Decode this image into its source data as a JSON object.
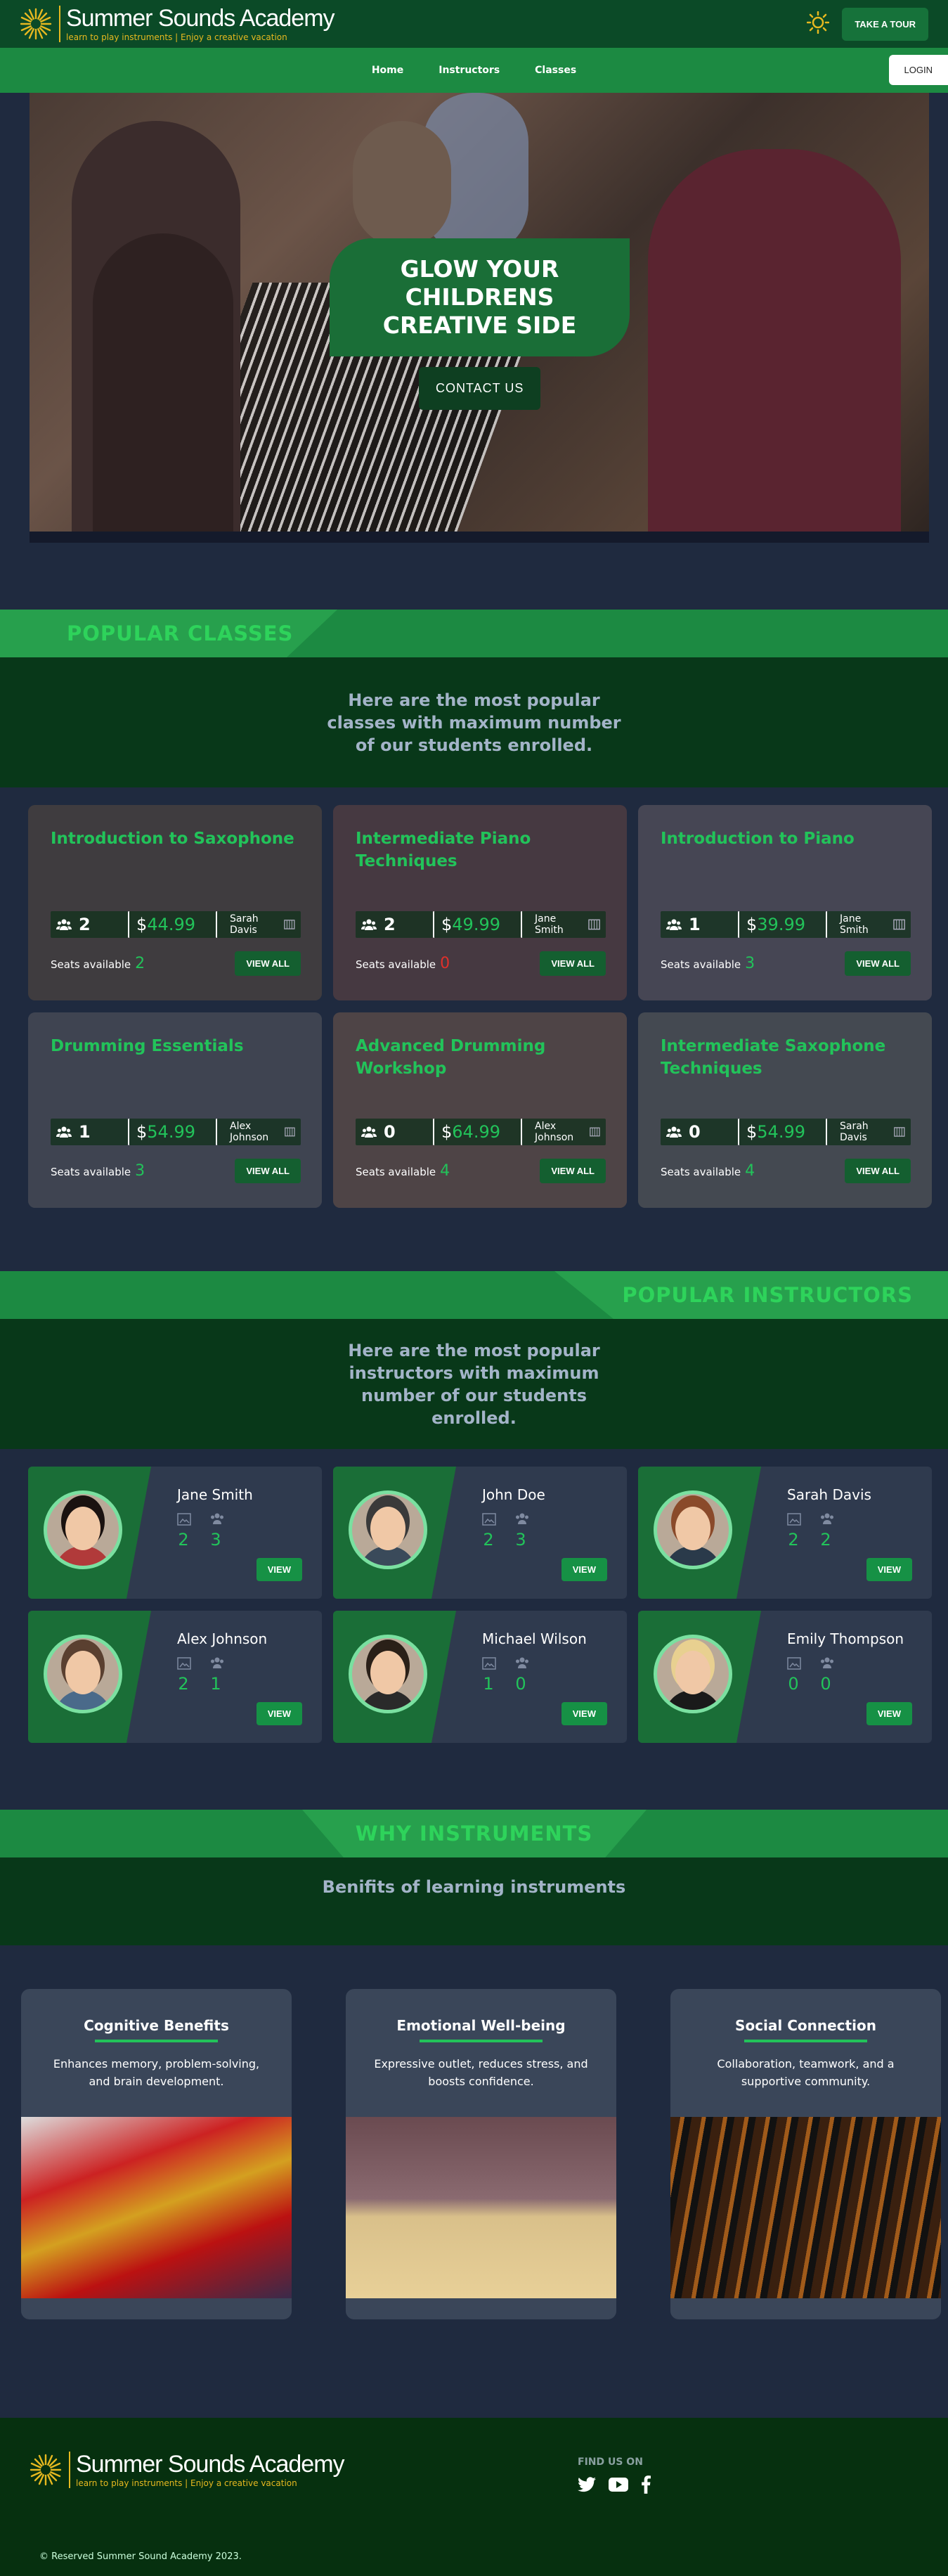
{
  "header": {
    "brand_name": "Summer Sounds Academy",
    "brand_tagline": "learn to play instruments | Enjoy a creative vacation",
    "tour_label": "TAKE A TOUR",
    "theme_icon": "sun-icon"
  },
  "nav": {
    "items": [
      "Home",
      "Instructors",
      "Classes"
    ],
    "login_label": "LOGIN"
  },
  "hero": {
    "title": "GLOW YOUR CHILDRENS CREATIVE SIDE",
    "cta_label": "CONTACT US"
  },
  "popular_classes": {
    "heading": "POPULAR CLASSES",
    "subtitle": "Here are the most popular classes with maximum number of our students enrolled.",
    "seats_label": "Seats available",
    "view_label": "VIEW ALL",
    "items": [
      {
        "title": "Introduction to Saxophone",
        "students": "2",
        "price": "44.99",
        "instructor": "Sarah Davis",
        "seats": "2",
        "seats_color": "#22c35a",
        "bg": "#4b4338"
      },
      {
        "title": "Intermediate Piano Techniques",
        "students": "2",
        "price": "49.99",
        "instructor": "Jane Smith",
        "seats": "0",
        "seats_color": "#e0302a",
        "bg": "#5a3d3d"
      },
      {
        "title": "Introduction to Piano",
        "students": "1",
        "price": "39.99",
        "instructor": "Jane Smith",
        "seats": "3",
        "seats_color": "#22c35a",
        "bg": "#5a5a66"
      },
      {
        "title": "Drumming Essentials",
        "students": "1",
        "price": "54.99",
        "instructor": "Alex Johnson",
        "seats": "3",
        "seats_color": "#22c35a",
        "bg": "#4a5560"
      },
      {
        "title": "Advanced Drumming Workshop",
        "students": "0",
        "price": "64.99",
        "instructor": "Alex Johnson",
        "seats": "4",
        "seats_color": "#22c35a",
        "bg": "#6a5548"
      },
      {
        "title": "Intermediate Saxophone Techniques",
        "students": "0",
        "price": "54.99",
        "instructor": "Sarah Davis",
        "seats": "4",
        "seats_color": "#22c35a",
        "bg": "#556060"
      }
    ]
  },
  "popular_instructors": {
    "heading": "POPULAR INSTRUCTORS",
    "subtitle": "Here are the most popular instructors with maximum number of our students enrolled.",
    "view_label": "VIEW",
    "items": [
      {
        "name": "Jane Smith",
        "classes": "2",
        "students": "3",
        "shirt": "#b13a3a",
        "hair": "#1a1210"
      },
      {
        "name": "John Doe",
        "classes": "2",
        "students": "3",
        "shirt": "#3a4a5a",
        "hair": "#3a3a3a"
      },
      {
        "name": "Sarah Davis",
        "classes": "2",
        "students": "2",
        "shirt": "#2a3a4a",
        "hair": "#8a4a2a"
      },
      {
        "name": "Alex Johnson",
        "classes": "2",
        "students": "1",
        "shirt": "#4a6a8a",
        "hair": "#5a4030"
      },
      {
        "name": "Michael Wilson",
        "classes": "1",
        "students": "0",
        "shirt": "#2a2a2a",
        "hair": "#2a2018"
      },
      {
        "name": "Emily Thompson",
        "classes": "0",
        "students": "0",
        "shirt": "#1a1a1a",
        "hair": "#e8d090"
      }
    ]
  },
  "why": {
    "heading": "WHY INSTRUMENTS",
    "subtitle": "Benifits of learning instruments",
    "items": [
      {
        "title": "Cognitive Benefits",
        "text": "Enhances memory, problem-solving, and brain development."
      },
      {
        "title": "Emotional Well-being",
        "text": "Expressive outlet, reduces stress, and boosts confidence."
      },
      {
        "title": "Social Connection",
        "text": "Collaboration, teamwork, and a supportive community."
      }
    ]
  },
  "footer": {
    "brand_name": "Summer Sounds Academy",
    "brand_tagline": "learn to play instruments | Enjoy a creative vacation",
    "find_us": "FIND US ON",
    "socials": [
      "twitter-icon",
      "youtube-icon",
      "facebook-icon"
    ],
    "copyright": "© Reserved Summer Sound Academy 2023."
  }
}
